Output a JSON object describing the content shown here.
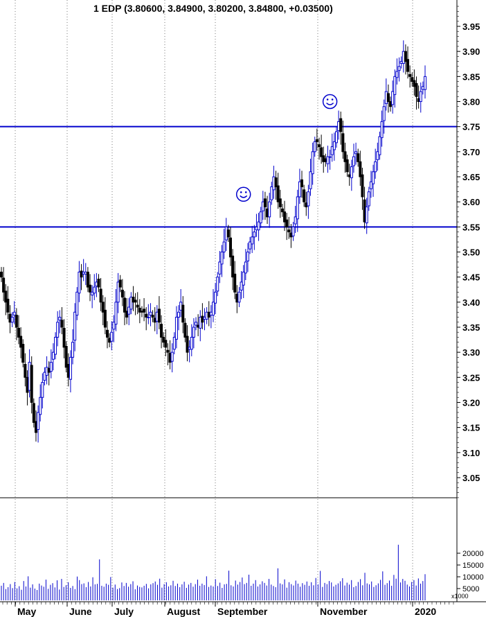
{
  "chart_data": {
    "type": "candlestick",
    "title": "1 EDP (3.80600, 3.84900, 3.80200, 3.84800, +0.03500)",
    "price_axis": {
      "ticks": [
        "3.95",
        "3.90",
        "3.85",
        "3.80",
        "3.75",
        "3.70",
        "3.65",
        "3.60",
        "3.55",
        "3.50",
        "3.45",
        "3.40",
        "3.35",
        "3.30",
        "3.25",
        "3.20",
        "3.15",
        "3.10",
        "3.05"
      ],
      "ylim": [
        3.0,
        4.0
      ]
    },
    "volume_axis": {
      "ticks": [
        "20000",
        "15000",
        "10000",
        "5000"
      ],
      "unit_label": "x1000",
      "ylim": [
        0,
        26000
      ]
    },
    "months": [
      "May",
      "June",
      "July",
      "August",
      "September",
      "November",
      "2020"
    ],
    "horizontal_lines": [
      3.75,
      3.55
    ],
    "line_color": "#0000cc",
    "up_color": "#0000cc",
    "down_color": "#000000",
    "annotations": [
      {
        "type": "smiley",
        "index": 112,
        "price": 3.615
      },
      {
        "type": "smiley",
        "index": 152,
        "price": 3.8
      }
    ],
    "close_series": [
      3.45,
      3.42,
      3.4,
      3.38,
      3.36,
      3.37,
      3.38,
      3.35,
      3.33,
      3.31,
      3.28,
      3.25,
      3.22,
      3.28,
      3.2,
      3.16,
      3.14,
      3.18,
      3.21,
      3.24,
      3.26,
      3.27,
      3.26,
      3.28,
      3.3,
      3.33,
      3.36,
      3.37,
      3.35,
      3.31,
      3.27,
      3.25,
      3.29,
      3.32,
      3.38,
      3.42,
      3.46,
      3.45,
      3.46,
      3.46,
      3.43,
      3.42,
      3.42,
      3.43,
      3.44,
      3.43,
      3.4,
      3.38,
      3.35,
      3.33,
      3.32,
      3.34,
      3.36,
      3.4,
      3.44,
      3.43,
      3.41,
      3.38,
      3.37,
      3.39,
      3.41,
      3.4,
      3.4,
      3.39,
      3.38,
      3.38,
      3.38,
      3.37,
      3.37,
      3.38,
      3.37,
      3.36,
      3.38,
      3.36,
      3.33,
      3.32,
      3.31,
      3.3,
      3.28,
      3.3,
      3.33,
      3.37,
      3.38,
      3.4,
      3.36,
      3.33,
      3.3,
      3.31,
      3.33,
      3.35,
      3.36,
      3.35,
      3.37,
      3.36,
      3.37,
      3.38,
      3.37,
      3.38,
      3.4,
      3.42,
      3.45,
      3.48,
      3.5,
      3.52,
      3.55,
      3.53,
      3.49,
      3.45,
      3.42,
      3.4,
      3.42,
      3.44,
      3.46,
      3.48,
      3.5,
      3.52,
      3.53,
      3.54,
      3.55,
      3.56,
      3.58,
      3.6,
      3.59,
      3.57,
      3.6,
      3.63,
      3.65,
      3.63,
      3.6,
      3.59,
      3.58,
      3.56,
      3.55,
      3.54,
      3.53,
      3.55,
      3.57,
      3.61,
      3.64,
      3.63,
      3.6,
      3.59,
      3.62,
      3.66,
      3.7,
      3.72,
      3.72,
      3.71,
      3.69,
      3.68,
      3.68,
      3.69,
      3.69,
      3.71,
      3.72,
      3.74,
      3.76,
      3.74,
      3.7,
      3.68,
      3.66,
      3.65,
      3.67,
      3.69,
      3.7,
      3.68,
      3.65,
      3.61,
      3.56,
      3.59,
      3.62,
      3.64,
      3.66,
      3.68,
      3.7,
      3.73,
      3.76,
      3.79,
      3.82,
      3.8,
      3.79,
      3.82,
      3.85,
      3.86,
      3.87,
      3.88,
      3.9,
      3.88,
      3.86,
      3.85,
      3.84,
      3.83,
      3.81,
      3.8,
      3.82,
      3.83,
      3.85
    ],
    "volume_series": [
      6200,
      7400,
      4800,
      5600,
      6900,
      5200,
      7800,
      5100,
      6000,
      4500,
      8200,
      5900,
      10200,
      5400,
      6800,
      5000,
      4400,
      7100,
      6300,
      5800,
      8800,
      4900,
      6600,
      7300,
      5500,
      8500,
      4600,
      9100,
      5700,
      6400,
      7700,
      5300,
      6100,
      4800,
      10100,
      8600,
      6900,
      7200,
      5600,
      7800,
      5900,
      9800,
      6800,
      7000,
      17400,
      6200,
      5800,
      7100,
      6600,
      9900,
      5400,
      6700,
      4800,
      5200,
      7600,
      6100,
      7400,
      5800,
      6900,
      8100,
      4700,
      6300,
      5700,
      5500,
      6200,
      7000,
      5100,
      6800,
      7300,
      8000,
      6600,
      9200,
      5400,
      6900,
      7700,
      5900,
      6400,
      8300,
      6100,
      7100,
      5600,
      6800,
      7900,
      5300,
      6700,
      7400,
      5800,
      6900,
      8800,
      6200,
      7100,
      6500,
      10200,
      5700,
      6300,
      5900,
      9000,
      6100,
      7500,
      5300,
      6800,
      7000,
      12600,
      6400,
      5900,
      8400,
      6700,
      7800,
      9700,
      6900,
      7400,
      10900,
      6200,
      7100,
      8600,
      5900,
      6800,
      8100,
      7400,
      6300,
      9100,
      6700,
      6100,
      5600,
      13600,
      7200,
      6800,
      8900,
      5400,
      7700,
      6900,
      6300,
      8400,
      7100,
      5800,
      7300,
      6600,
      8000,
      6200,
      7700,
      6400,
      9500,
      6800,
      12500,
      5700,
      7400,
      6900,
      8200,
      7600,
      5900,
      6600,
      7200,
      8100,
      9400,
      6300,
      7500,
      6700,
      8600,
      5600,
      6100,
      7800,
      9000,
      6400,
      11700,
      7200,
      6800,
      8000,
      5700,
      6400,
      7200,
      8700,
      12300,
      6600,
      7300,
      8400,
      6200,
      10800,
      9200,
      23600,
      7600,
      9100,
      8300,
      6700,
      5900,
      7800,
      8600,
      6300,
      9300,
      7100,
      8200,
      11100
    ]
  }
}
